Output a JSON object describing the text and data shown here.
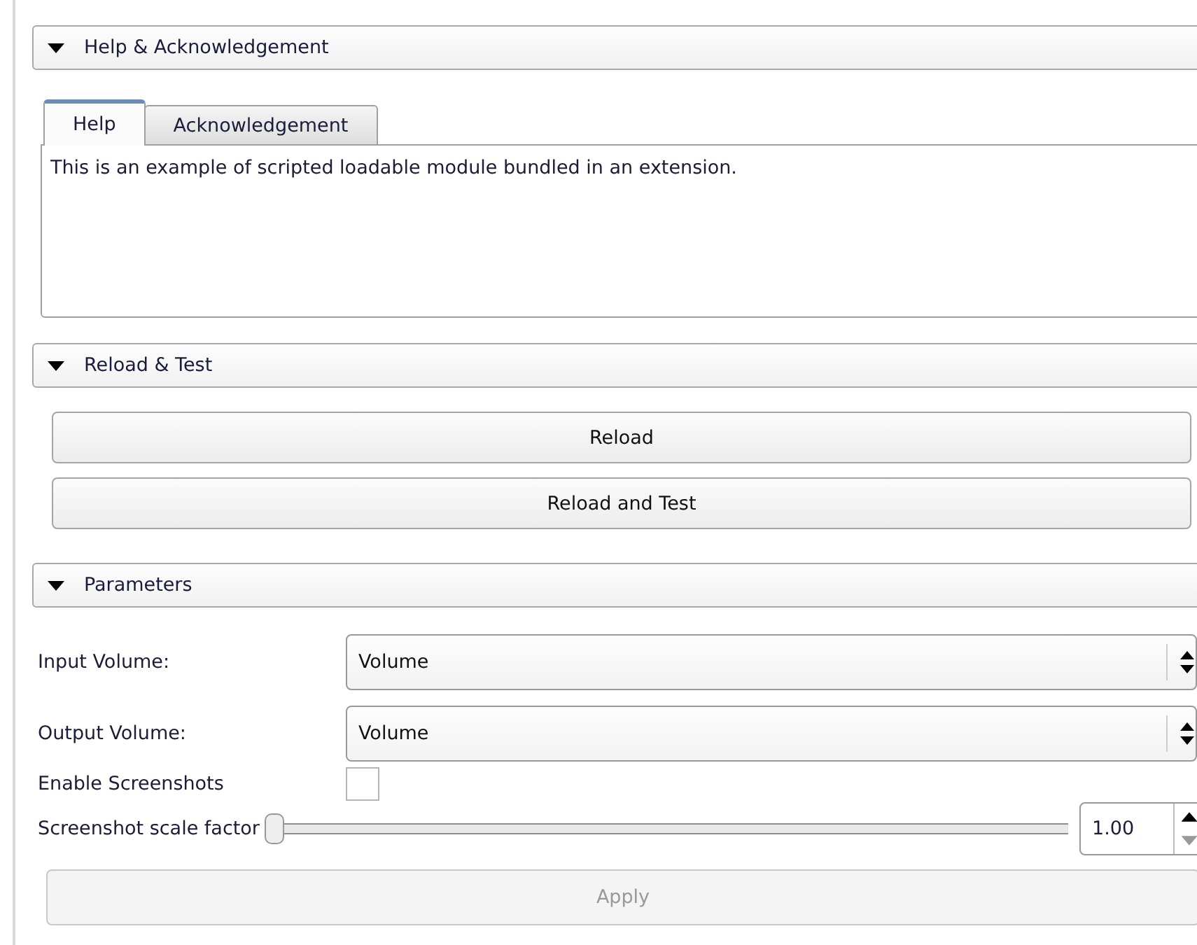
{
  "sections": [
    {
      "title": "Help & Acknowledgement",
      "expanded": true,
      "kind": "tabs",
      "tabs": [
        {
          "label": "Help",
          "selected": true
        },
        {
          "label": "Acknowledgement",
          "selected": false
        }
      ],
      "text": "This is an example of scripted loadable module bundled in an extension."
    },
    {
      "title": "Reload & Test",
      "expanded": true,
      "kind": "buttons",
      "buttons": [
        {
          "label": "Reload"
        },
        {
          "label": "Reload and Test"
        }
      ]
    },
    {
      "title": "Parameters",
      "expanded": true,
      "kind": "form",
      "rows": [
        {
          "kind": "combo",
          "label": "Input Volume:",
          "value": "Volume"
        },
        {
          "kind": "combo",
          "label": "Output Volume:",
          "value": "Volume"
        },
        {
          "kind": "checkbox",
          "label": "Enable Screenshots",
          "checked": false
        },
        {
          "kind": "slider",
          "label": "Screenshot scale factor",
          "level": 0,
          "value": "1.00"
        }
      ],
      "apply": {
        "label": "Apply",
        "disabled": true
      }
    }
  ]
}
